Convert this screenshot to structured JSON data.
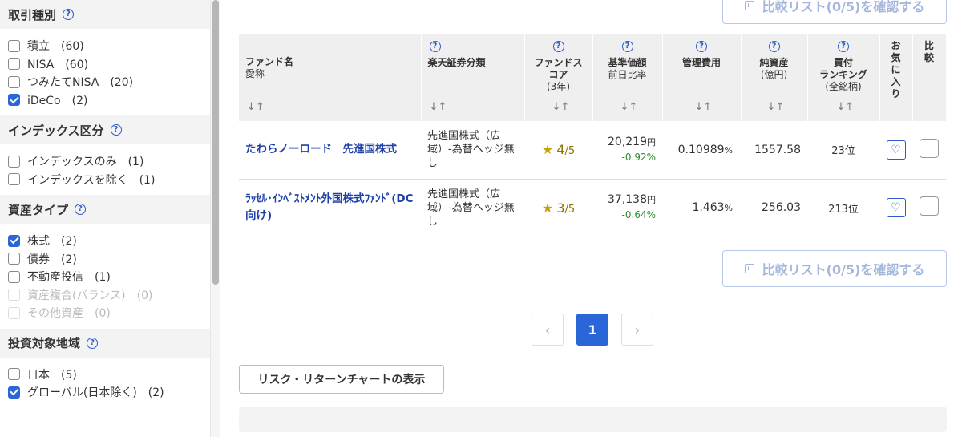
{
  "sidebar": {
    "sections": [
      {
        "title": "取引種別",
        "options": [
          {
            "label": "積立　(60)",
            "checked": false,
            "disabled": false
          },
          {
            "label": "NISA　(60)",
            "checked": false,
            "disabled": false
          },
          {
            "label": "つみたてNISA　(20)",
            "checked": false,
            "disabled": false
          },
          {
            "label": "iDeCo　(2)",
            "checked": true,
            "disabled": false
          }
        ]
      },
      {
        "title": "インデックス区分",
        "options": [
          {
            "label": "インデックスのみ　(1)",
            "checked": false,
            "disabled": false
          },
          {
            "label": "インデックスを除く　(1)",
            "checked": false,
            "disabled": false
          }
        ]
      },
      {
        "title": "資産タイプ",
        "options": [
          {
            "label": "株式　(2)",
            "checked": true,
            "disabled": false
          },
          {
            "label": "債券　(2)",
            "checked": false,
            "disabled": false
          },
          {
            "label": "不動産投信　(1)",
            "checked": false,
            "disabled": false
          },
          {
            "label": "資産複合(バランス)　(0)",
            "checked": false,
            "disabled": true
          },
          {
            "label": "その他資産　(0)",
            "checked": false,
            "disabled": true
          }
        ]
      },
      {
        "title": "投資対象地域",
        "options": [
          {
            "label": "日本　(5)",
            "checked": false,
            "disabled": false
          },
          {
            "label": "グローバル(日本除く)　(2)",
            "checked": true,
            "disabled": false
          }
        ]
      }
    ]
  },
  "compare_button": {
    "label": "比較リスト(0/5)を確認する"
  },
  "table": {
    "headers": {
      "fund_name": "ファンド名",
      "fund_alias": "愛称",
      "classification": "楽天証券分類",
      "score_1": "ファンドス",
      "score_2": "コア",
      "score_sub": "(3年)",
      "nav": "基準価額",
      "nav_sub": "前日比率",
      "fee": "管理費用",
      "assets": "純資産",
      "assets_sub": "(億円)",
      "rank_1": "買付",
      "rank_2": "ランキング",
      "rank_sub": "(全銘柄)",
      "favorite": "お気に入り",
      "compare": "比較",
      "sort_icon": "↓↑"
    },
    "rows": [
      {
        "name": "たわらノーロード　先進国株式",
        "classification": "先進国株式（広域）-為替ヘッジ無し",
        "score": "4",
        "score_max": "/5",
        "nav": "20,219",
        "nav_unit": "円",
        "change": "-0.92%",
        "fee": "0.10989",
        "fee_unit": "%",
        "assets": "1557.58",
        "rank": "23",
        "rank_unit": "位"
      },
      {
        "name": "ﾗｯｾﾙ･ｲﾝﾍﾞｽﾄﾒﾝﾄ外国株式ﾌｧﾝﾄﾞ(DC向け)",
        "classification": "先進国株式（広域）-為替ヘッジ無し",
        "score": "3",
        "score_max": "/5",
        "nav": "37,138",
        "nav_unit": "円",
        "change": "-0.64%",
        "fee": "1.463",
        "fee_unit": "%",
        "assets": "256.03",
        "rank": "213",
        "rank_unit": "位"
      }
    ]
  },
  "pagination": {
    "prev": "‹",
    "current": "1",
    "next": "›"
  },
  "risk_button": {
    "label": "リスク・リターンチャートの表示"
  },
  "icons": {
    "help": "?",
    "star": "★",
    "heart": "♡"
  }
}
